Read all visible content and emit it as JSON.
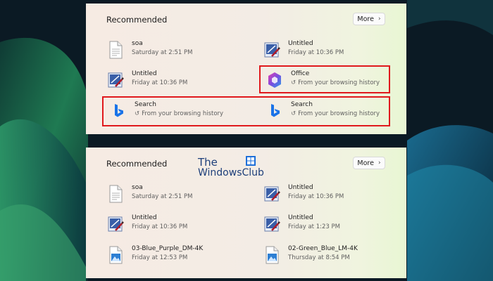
{
  "colors": {
    "highlight": "#e0191d",
    "panel_bg": "#f4ece4",
    "watermark": "#1e3f7a"
  },
  "panels": [
    {
      "title": "Recommended",
      "more_label": "More",
      "items": [
        {
          "name": "soa",
          "sub": "Saturday at 2:51 PM",
          "icon": "document-icon",
          "history": false
        },
        {
          "name": "Untitled",
          "sub": "Friday at 10:36 PM",
          "icon": "paint-file-icon",
          "history": false
        },
        {
          "name": "Untitled",
          "sub": "Friday at 10:36 PM",
          "icon": "paint-file-icon",
          "history": false
        },
        {
          "name": "Office",
          "sub": "From your browsing history",
          "icon": "office-icon",
          "history": true
        },
        {
          "name": "Search",
          "sub": "From your browsing history",
          "icon": "bing-icon",
          "history": true
        },
        {
          "name": "Search",
          "sub": "From your browsing history",
          "icon": "bing-icon",
          "history": true
        }
      ]
    },
    {
      "title": "Recommended",
      "more_label": "More",
      "items": [
        {
          "name": "soa",
          "sub": "Saturday at 2:51 PM",
          "icon": "document-icon",
          "history": false
        },
        {
          "name": "Untitled",
          "sub": "Friday at 10:36 PM",
          "icon": "paint-file-icon",
          "history": false
        },
        {
          "name": "Untitled",
          "sub": "Friday at 10:36 PM",
          "icon": "paint-file-icon",
          "history": false
        },
        {
          "name": "Untitled",
          "sub": "Friday at 1:23 PM",
          "icon": "paint-file-icon",
          "history": false
        },
        {
          "name": "03-Blue_Purple_DM-4K",
          "sub": "Friday at 12:53 PM",
          "icon": "image-file-icon",
          "history": false
        },
        {
          "name": "02-Green_Blue_LM-4K",
          "sub": "Thursday at 8:54 PM",
          "icon": "image-file-icon",
          "history": false
        }
      ]
    }
  ],
  "watermark": {
    "line1": "The",
    "line2": "WindowsClub"
  }
}
